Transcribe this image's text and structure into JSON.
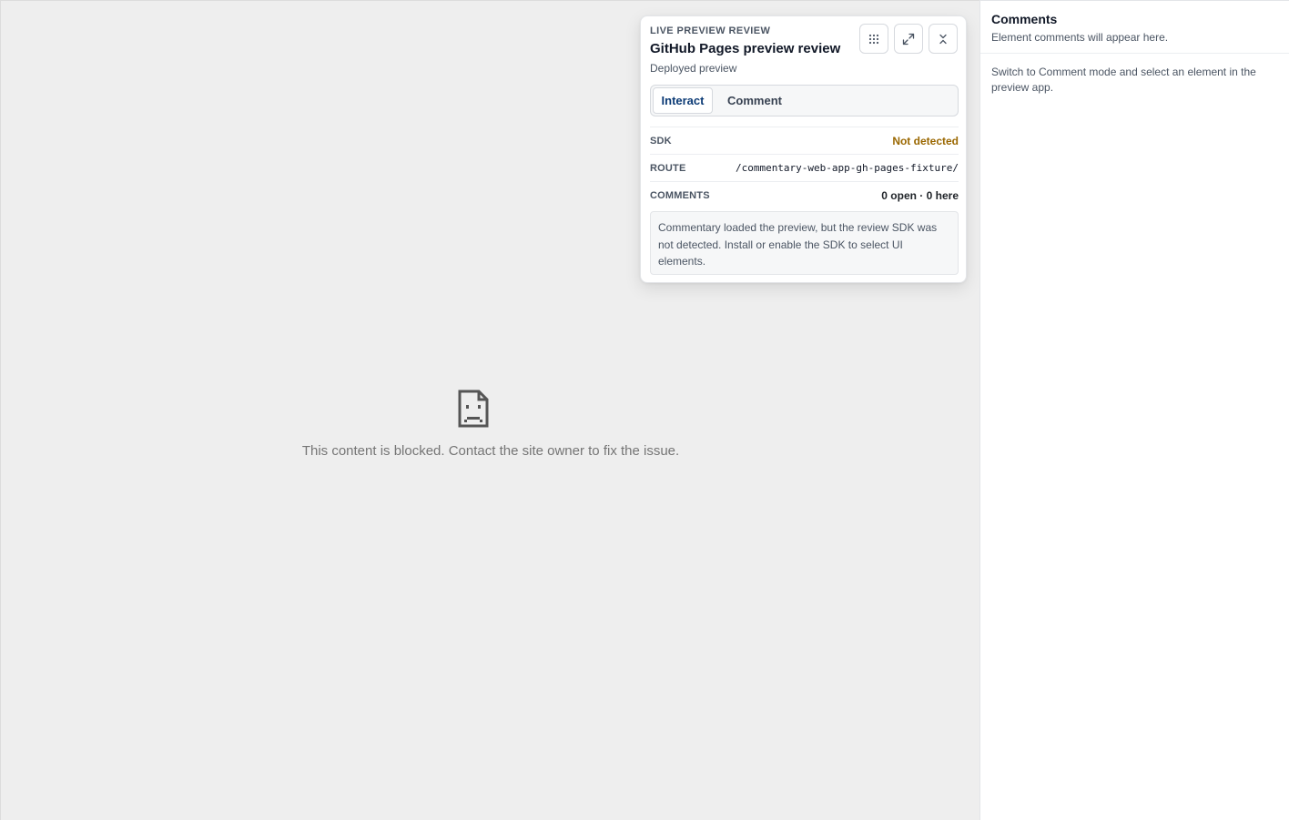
{
  "preview": {
    "blocked_message": "This content is blocked. Contact the site owner to fix the issue.",
    "blocked_icon": "sad-document-icon"
  },
  "review_card": {
    "eyebrow": "LIVE PREVIEW REVIEW",
    "title": "GitHub Pages preview review",
    "subtitle": "Deployed preview",
    "buttons": {
      "grid_icon": "drag-grid-icon",
      "expand_icon": "expand-icon",
      "collapse_icon": "collapse-icon"
    },
    "modes": {
      "interact_label": "Interact",
      "comment_label": "Comment",
      "active": "Interact"
    },
    "rows": {
      "sdk_label": "SDK",
      "sdk_value": "Not detected",
      "route_label": "ROUTE",
      "route_value": "/commentary-web-app-gh-pages-fixture/",
      "comments_label": "COMMENTS",
      "comments_value": "0 open · 0 here"
    },
    "notice": "Commentary loaded the preview, but the review SDK was not detected. Install or enable the SDK to select UI elements.",
    "colors": {
      "warning": "#9a6700",
      "active_tab": "#0b3a75"
    }
  },
  "sidebar": {
    "title": "Comments",
    "subtitle": "Element comments will appear here.",
    "empty_state": "Switch to Comment mode and select an element in the preview app."
  }
}
